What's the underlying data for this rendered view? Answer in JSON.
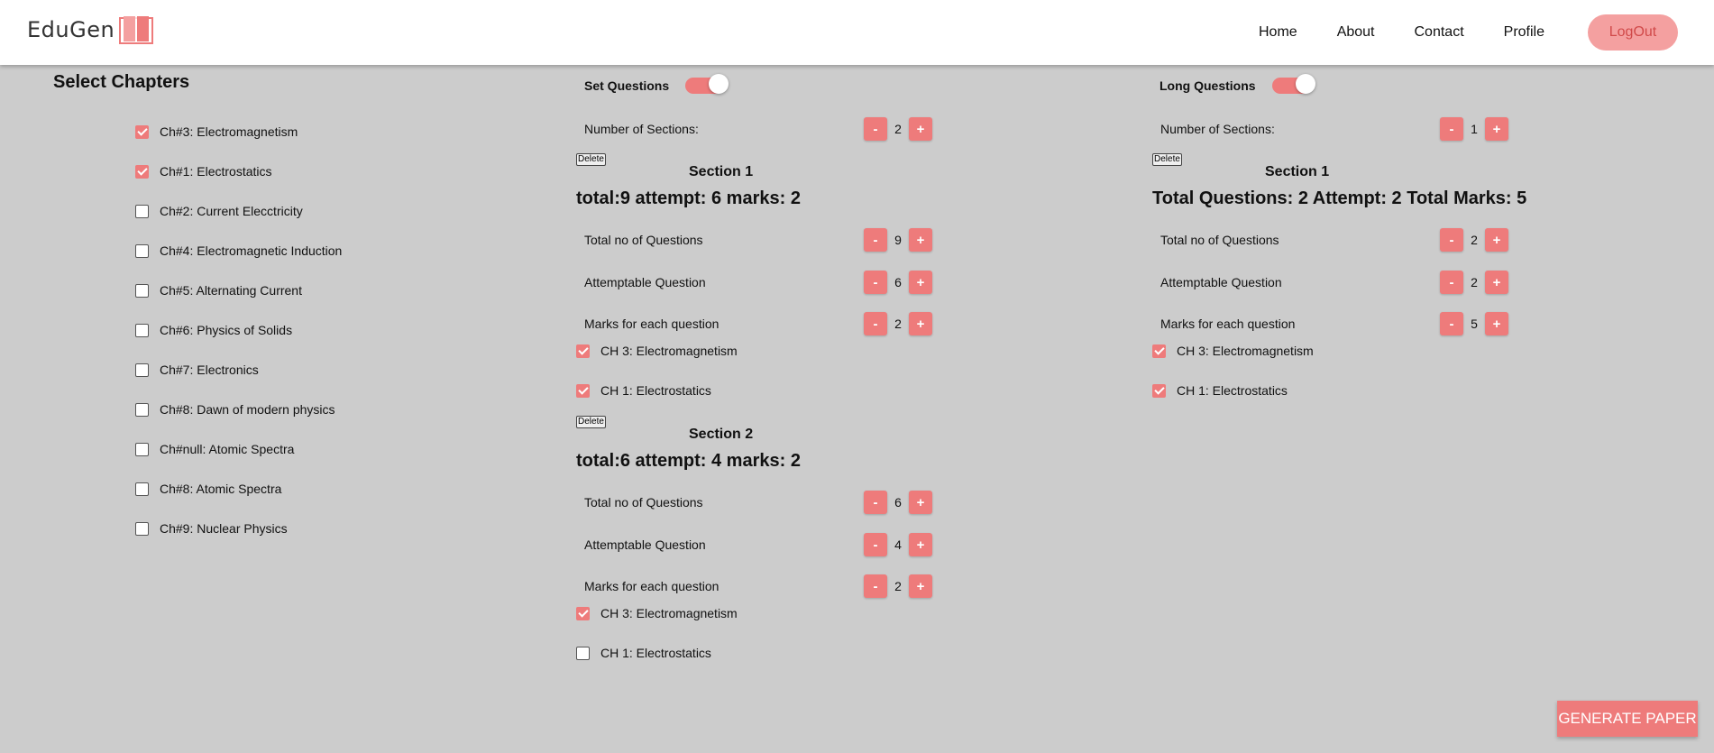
{
  "header": {
    "logo_text": "EduGen",
    "nav": [
      "Home",
      "About",
      "Contact",
      "Profile"
    ],
    "logout_label": "LogOut"
  },
  "chapters": {
    "title": "Select Chapters",
    "items": [
      {
        "label": "Ch#3: Electromagnetism",
        "checked": true
      },
      {
        "label": "Ch#1: Electrostatics",
        "checked": true
      },
      {
        "label": "Ch#2: Current Elecctricity",
        "checked": false
      },
      {
        "label": "Ch#4: Electromagnetic Induction",
        "checked": false
      },
      {
        "label": "Ch#5: Alternating Current",
        "checked": false
      },
      {
        "label": "Ch#6: Physics of Solids",
        "checked": false
      },
      {
        "label": "Ch#7: Electronics",
        "checked": false
      },
      {
        "label": "Ch#8: Dawn of modern physics",
        "checked": false
      },
      {
        "label": "Ch#null: Atomic Spectra",
        "checked": false
      },
      {
        "label": "Ch#8: Atomic Spectra",
        "checked": false
      },
      {
        "label": "Ch#9: Nuclear Physics",
        "checked": false
      }
    ]
  },
  "set_questions": {
    "toggle_label": "Set Questions",
    "num_sections_label": "Number of Sections:",
    "num_sections": "2",
    "sections": [
      {
        "delete_label": "Delete",
        "title": "Section 1",
        "summary": "total:9 attempt: 6 marks: 2",
        "total_label": "Total no of Questions",
        "total": "9",
        "attempt_label": "Attemptable Question",
        "attempt": "6",
        "marks_label": "Marks for each question",
        "marks": "2",
        "chapters": [
          {
            "label": "CH 3: Electromagnetism",
            "checked": true
          },
          {
            "label": "CH 1: Electrostatics",
            "checked": true
          }
        ]
      },
      {
        "delete_label": "Delete",
        "title": "Section 2",
        "summary": "total:6 attempt: 4 marks: 2",
        "total_label": "Total no of Questions",
        "total": "6",
        "attempt_label": "Attemptable Question",
        "attempt": "4",
        "marks_label": "Marks for each question",
        "marks": "2",
        "chapters": [
          {
            "label": "CH 3: Electromagnetism",
            "checked": true
          },
          {
            "label": "CH 1: Electrostatics",
            "checked": false
          }
        ]
      }
    ]
  },
  "long_questions": {
    "toggle_label": "Long Questions",
    "num_sections_label": "Number of Sections:",
    "num_sections": "1",
    "sections": [
      {
        "delete_label": "Delete",
        "title": "Section 1",
        "summary": "Total Questions: 2 Attempt: 2 Total Marks: 5",
        "total_label": "Total no of Questions",
        "total": "2",
        "attempt_label": "Attemptable Question",
        "attempt": "2",
        "marks_label": "Marks for each question",
        "marks": "5",
        "chapters": [
          {
            "label": "CH 3: Electromagnetism",
            "checked": true
          },
          {
            "label": "CH 1: Electrostatics",
            "checked": true
          }
        ]
      }
    ]
  },
  "stepper": {
    "minus": "-",
    "plus": "+"
  },
  "generate_label": "GENERATE PAPER",
  "colors": {
    "accent": "#ee7b7b",
    "background": "#cccccc",
    "logout_bg": "#f4a0a0"
  }
}
